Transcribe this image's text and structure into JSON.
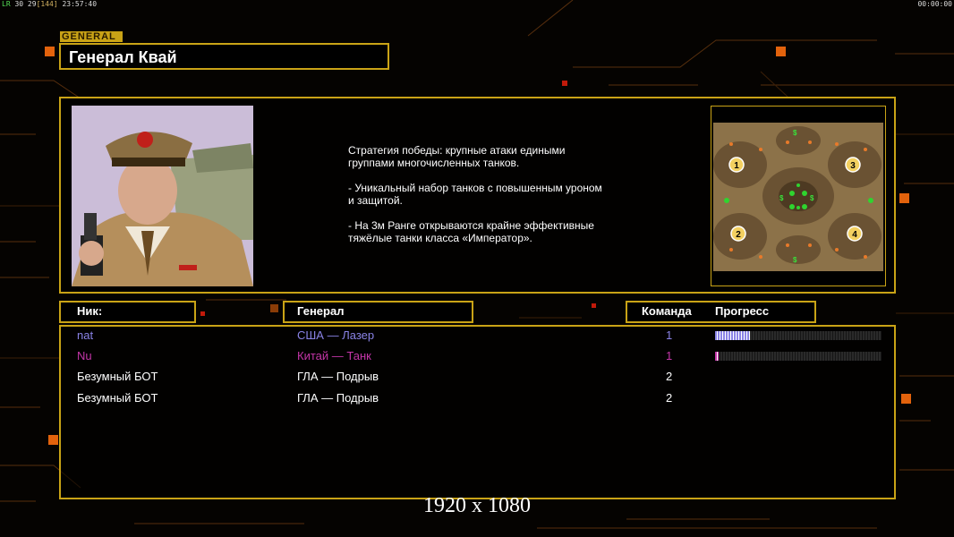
{
  "hud": {
    "fps_label": "LR",
    "fps_values": "30 29",
    "bracket": "[144]",
    "clock": "23:57:40",
    "timer": "00:00:00"
  },
  "general": {
    "tag": "GENERAL",
    "name": "Генерал Квай"
  },
  "description": {
    "lines": [
      "Стратегия победы: крупные атаки едиными\n группами многочисленных танков.",
      "- Уникальный набор танков с повышенным уроном\n и защитой.",
      "- На 3м Ранге открываются крайне эффективные\n тяжёлые танки класса «Император»."
    ]
  },
  "map": {
    "slot_labels": [
      "1",
      "2",
      "3",
      "4"
    ],
    "marker_letter": "$"
  },
  "table": {
    "headers": {
      "nick": "Ник:",
      "general": "Генерал",
      "team": "Команда",
      "progress": "Прогресс"
    },
    "rows": [
      {
        "nick": "nat",
        "general": "США — Лазер",
        "team": "1",
        "progress": 0.21,
        "color": "#8a83e6"
      },
      {
        "nick": "Nu",
        "general": "Китай — Танк",
        "team": "1",
        "progress": 0.02,
        "color": "#c436a8"
      },
      {
        "nick": "Безумный БОТ",
        "general": "ГЛА — Подрыв",
        "team": "2",
        "color": "#ffffff"
      },
      {
        "nick": "Безумный БОТ",
        "general": "ГЛА — Подрыв",
        "team": "2",
        "color": "#ffffff"
      }
    ]
  },
  "resolution": "1920 x 1080",
  "colors": {
    "gold": "#c9a316",
    "accent": "#e2620c"
  }
}
